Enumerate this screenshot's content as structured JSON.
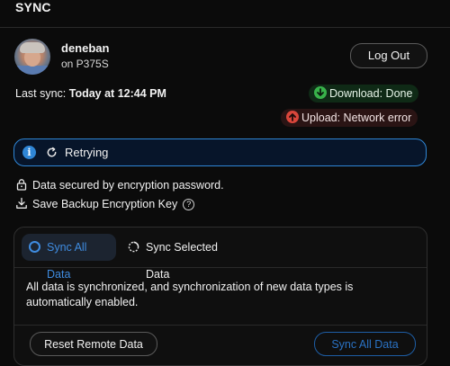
{
  "header": {
    "title": "SYNC"
  },
  "account": {
    "name": "deneban",
    "device": "on P375S",
    "logout_label": "Log Out"
  },
  "last_sync": {
    "label": "Last sync: ",
    "value": "Today at 12:44 PM"
  },
  "status": {
    "download": {
      "label": "Download: Done",
      "color": "#38b24a"
    },
    "upload": {
      "label": "Upload: Network error",
      "color": "#d9463b"
    }
  },
  "retry": {
    "label": "Retrying",
    "accent": "#2f86d6"
  },
  "security": {
    "secured_label": "Data secured by encryption password.",
    "backup_label": "Save Backup Encryption Key",
    "help_glyph": "?"
  },
  "sync_card": {
    "tabs": [
      {
        "label": "Sync All Data",
        "selected": true
      },
      {
        "label": "Sync Selected Data",
        "selected": false
      }
    ],
    "description": "All data is synchronized, and synchronization of new data types is automatically enabled.",
    "reset_label": "Reset Remote Data",
    "sync_all_label": "Sync All Data"
  },
  "icons": {
    "info": "info-icon",
    "retry": "refresh-icon",
    "lock": "lock-icon",
    "download": "download-icon",
    "help": "help-icon"
  }
}
